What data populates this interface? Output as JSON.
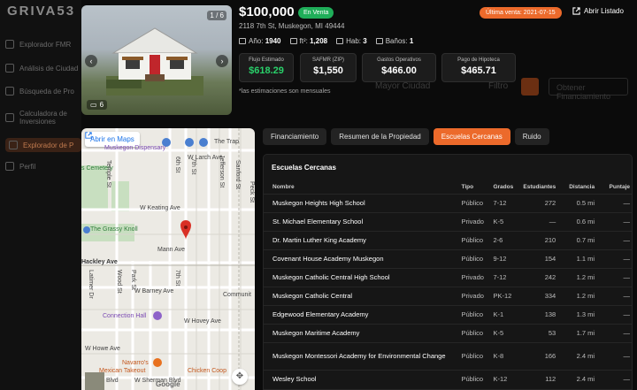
{
  "background": {
    "logo": "GRIVA53",
    "nav": [
      "Explorador FMR",
      "Análisis de Ciudad",
      "Búsqueda de Pro",
      "Calculadora de Inversiones",
      "Explorador de P",
      "Perfil"
    ],
    "search_placeholder": "Mayor Ciudad",
    "filter_label": "Filtro",
    "search_button": "Obtener Financiamiento"
  },
  "listing": {
    "price": "$100,000",
    "status": "En Venta",
    "address": "2118 7th St, Muskegon, MI 49444",
    "last_sale": "Última venta: 2021-07-15",
    "open_listing": "Abrir Listado",
    "photo_counter": "1 / 6",
    "photo_count": "6",
    "facts": {
      "year_label": "Año:",
      "year": "1940",
      "sqft_label": "ft²:",
      "sqft": "1,208",
      "beds_label": "Hab:",
      "beds": "3",
      "baths_label": "Baños:",
      "baths": "1"
    },
    "stats": [
      {
        "label": "Flujo Estimado",
        "value": "$618.29"
      },
      {
        "label": "SAFMR (ZIP)",
        "value": "$1,550"
      },
      {
        "label": "Gastos Operativos",
        "value": "$466.00"
      },
      {
        "label": "Pago de Hipoteca",
        "value": "$465.71"
      }
    ],
    "estimate_note": "*las estimaciones son mensuales"
  },
  "map": {
    "open_in_maps": "Abrir en Maps",
    "labels": {
      "dispensary": "Muskegon Dispensary",
      "cemetery": "s Cemetery",
      "larch": "W Larch Ave",
      "keating": "W Keating Ave",
      "grassy": "The Grassy Knoll",
      "mann": "Mann Ave",
      "hackley": "Hackley Ave",
      "barney": "W Barney Ave",
      "connection": "Connection Hall",
      "hovey": "W Hovey Ave",
      "howe": "W Howe Ave",
      "navarro": "Navarro's",
      "takeout": "Mexican Takeout",
      "chicken": "Chicken Coop",
      "sherman": "W Sherman Blvd",
      "trap": "The Trap",
      "communit": "Communit",
      "sixth": "6th St",
      "seventh": "7th St",
      "jefferson": "Jefferson St",
      "sanford": "Sanford St",
      "peck": "Peck St",
      "temple": "Temple St",
      "park": "Park St",
      "wood": "Wood St",
      "latimer": "Latimer Dr",
      "blvd": "Blvd"
    },
    "google": "Google"
  },
  "tabs": [
    {
      "label": "Financiamiento",
      "active": false
    },
    {
      "label": "Resumen de la Propiedad",
      "active": false
    },
    {
      "label": "Escuelas Cercanas",
      "active": true
    },
    {
      "label": "Ruido",
      "active": false
    }
  ],
  "schools": {
    "title": "Escuelas Cercanas",
    "columns": [
      "Nombre",
      "Tipo",
      "Grados",
      "Estudiantes",
      "Distancia",
      "Puntaje"
    ],
    "rows": [
      {
        "name": "Muskegon Heights High School",
        "type": "Público",
        "grades": "7-12",
        "students": "272",
        "distance": "0.5 mi",
        "score": "—"
      },
      {
        "name": "St. Michael Elementary School",
        "type": "Privado",
        "grades": "K-5",
        "students": "—",
        "distance": "0.6 mi",
        "score": "—"
      },
      {
        "name": "Dr. Martin Luther King Academy",
        "type": "Público",
        "grades": "2-6",
        "students": "210",
        "distance": "0.7 mi",
        "score": "—"
      },
      {
        "name": "Covenant House Academy Muskegon",
        "type": "Público",
        "grades": "9-12",
        "students": "154",
        "distance": "1.1 mi",
        "score": "—"
      },
      {
        "name": "Muskegon Catholic Central High School",
        "type": "Privado",
        "grades": "7-12",
        "students": "242",
        "distance": "1.2 mi",
        "score": "—"
      },
      {
        "name": "Muskegon Catholic Central",
        "type": "Privado",
        "grades": "PK-12",
        "students": "334",
        "distance": "1.2 mi",
        "score": "—"
      },
      {
        "name": "Edgewood Elementary Academy",
        "type": "Público",
        "grades": "K-1",
        "students": "138",
        "distance": "1.3 mi",
        "score": "—"
      },
      {
        "name": "Muskegon Maritime Academy",
        "type": "Público",
        "grades": "K-5",
        "students": "53",
        "distance": "1.7 mi",
        "score": "—"
      },
      {
        "name": "Muskegon Montessori Academy for Environmental Change",
        "type": "Público",
        "grades": "K-8",
        "students": "166",
        "distance": "2.4 mi",
        "score": "—"
      },
      {
        "name": "Wesley School",
        "type": "Público",
        "grades": "K-12",
        "students": "112",
        "distance": "2.4 mi",
        "score": "—"
      }
    ]
  },
  "colors": {
    "accent": "#ec6a2b",
    "positive": "#29d16a",
    "status_green": "#1fae59"
  }
}
